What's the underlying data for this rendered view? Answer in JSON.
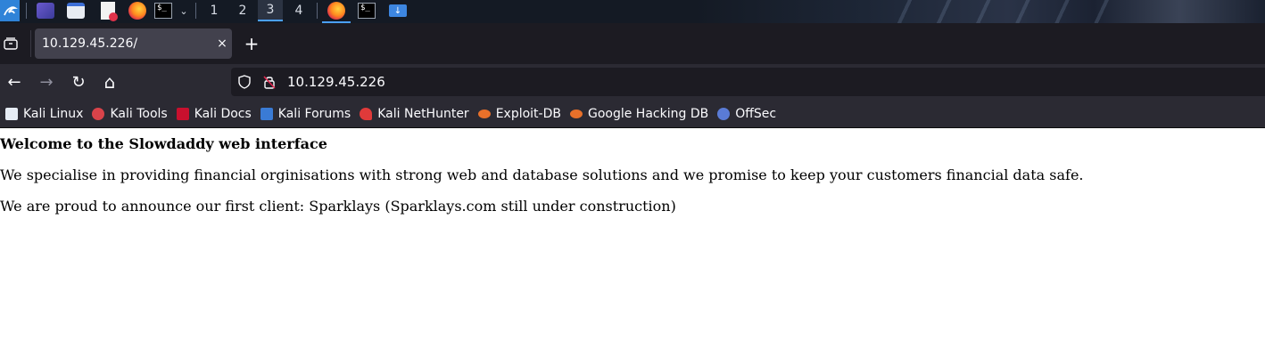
{
  "taskbar": {
    "workspaces": [
      "1",
      "2",
      "3",
      "4"
    ],
    "active_workspace": "3",
    "terminal_prompt": "$_"
  },
  "tab": {
    "title": "10.129.45.226/",
    "close": "×",
    "new_tab": "+"
  },
  "nav": {
    "back": "←",
    "forward": "→",
    "reload": "↻",
    "home": "⌂",
    "url": "10.129.45.226"
  },
  "bookmarks": [
    {
      "label": "Kali Linux",
      "icon": "kali-dragon-icon",
      "color": "#2f83d8"
    },
    {
      "label": "Kali Tools",
      "icon": "kali-tools-icon",
      "color": "#d9434a"
    },
    {
      "label": "Kali Docs",
      "icon": "kali-docs-icon",
      "color": "#c8102e"
    },
    {
      "label": "Kali Forums",
      "icon": "kali-forums-icon",
      "color": "#3a7bd5"
    },
    {
      "label": "Kali NetHunter",
      "icon": "nethunter-icon",
      "color": "#e03a3a"
    },
    {
      "label": "Exploit-DB",
      "icon": "exploit-db-icon",
      "color": "#e8702a"
    },
    {
      "label": "Google Hacking DB",
      "icon": "ghdb-icon",
      "color": "#e8702a"
    },
    {
      "label": "OffSec",
      "icon": "offsec-icon",
      "color": "#5a7bd6"
    }
  ],
  "page": {
    "heading": "Welcome to the Slowdaddy web interface",
    "paragraph1": "We specialise in providing financial orginisations with strong web and database solutions and we promise to keep your customers financial data safe.",
    "paragraph2": "We are proud to announce our first client: Sparklays (Sparklays.com still under construction)"
  },
  "colors": {
    "taskbar_bg": "#141a24",
    "accent": "#4aa0ff",
    "tabbar_bg": "#1c1b22",
    "toolbar_bg": "#2b2a33",
    "active_tab_bg": "#42414d"
  }
}
